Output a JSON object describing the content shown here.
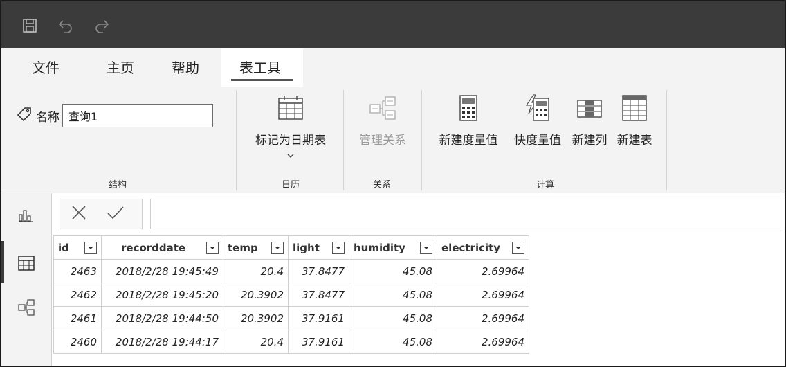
{
  "tabs": [
    {
      "label": "文件"
    },
    {
      "label": "主页"
    },
    {
      "label": "帮助"
    },
    {
      "label": "表工具"
    }
  ],
  "ribbon": {
    "name_label": "名称",
    "name_value": "查询1",
    "groups": {
      "structure": "结构",
      "calendar": "日历",
      "relations": "关系",
      "calc": "计算"
    },
    "buttons": {
      "mark_date_table": "标记为日期表",
      "manage_relations": "管理关系",
      "new_measure": "新建度量值",
      "quick_measure": "快度量值",
      "new_column": "新建列",
      "new_table": "新建表"
    }
  },
  "table": {
    "columns": [
      "id",
      "recorddate",
      "temp",
      "light",
      "humidity",
      "electricity"
    ],
    "rows": [
      [
        "2463",
        "2018/2/28 19:45:49",
        "20.4",
        "37.8477",
        "45.08",
        "2.69964"
      ],
      [
        "2462",
        "2018/2/28 19:45:20",
        "20.3902",
        "37.8477",
        "45.08",
        "2.69964"
      ],
      [
        "2461",
        "2018/2/28 19:44:50",
        "20.3902",
        "37.9161",
        "45.08",
        "2.69964"
      ],
      [
        "2460",
        "2018/2/28 19:44:17",
        "20.4",
        "37.9161",
        "45.08",
        "2.69964"
      ]
    ]
  },
  "colors": {
    "titlebar": "#3b3b3b",
    "ribbon_bg": "#f3f3f3",
    "grid_border": "#cfcfcf"
  },
  "icons": {
    "save": "save-icon",
    "undo": "undo-icon",
    "redo": "redo-icon",
    "tag": "tag-icon",
    "report_view": "bar-chart-icon",
    "data_view": "table-icon",
    "model_view": "model-icon"
  }
}
